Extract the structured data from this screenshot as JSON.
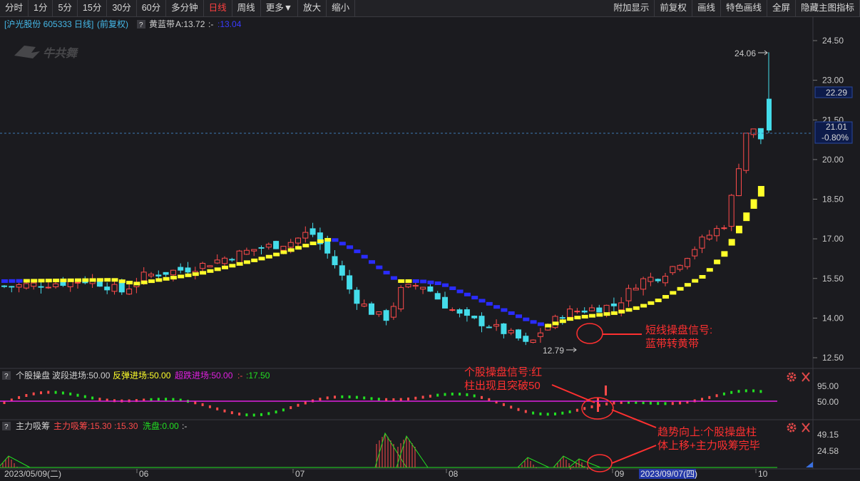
{
  "toolbar": {
    "left": [
      "分时",
      "1分",
      "5分",
      "15分",
      "30分",
      "60分",
      "多分钟",
      "日线",
      "周线",
      "更多▼",
      "放大",
      "缩小"
    ],
    "active": "日线",
    "right": [
      "附加显示",
      "前复权",
      "画线",
      "特色画线",
      "全屏",
      "隐藏主图指标"
    ]
  },
  "main": {
    "stock_label": "[沪光股份 605333 日线]",
    "adjust_label": "(前复权)",
    "q_icon": "?",
    "indicator_name": "黄蓝带",
    "indicator_a": "A:13.72",
    "indicator_dash": ":-",
    "indicator_b": ":13.04",
    "watermark": "牛共舞",
    "high_label": "24.06",
    "low_label": "12.79",
    "price_ticks": [
      "24.50",
      "23.00",
      "21.50",
      "20.00",
      "18.50",
      "17.00",
      "15.50",
      "14.00",
      "12.50"
    ],
    "badge_top": "22.29",
    "badge_price": "21.01",
    "badge_pct": "-0.80%"
  },
  "ind1": {
    "q_icon": "?",
    "name": "个股操盘",
    "s1": "波段进场:50.00",
    "s2": "反弹进场:50.00",
    "s3": "超跌进场:50.00",
    "s4": ":-",
    "s5": ":17.50",
    "ticks": [
      "95.00",
      "50.00"
    ]
  },
  "ind2": {
    "q_icon": "?",
    "name": "主力吸筹",
    "s1": "主力吸筹:15.30",
    "s2": ":15.30",
    "s3": "洗盘:0.00",
    "s4": ":-",
    "ticks": [
      "49.15",
      "24.58"
    ]
  },
  "xaxis": {
    "start": "2023/05/09(二)",
    "months": [
      "06",
      "07",
      "08",
      "09",
      "10"
    ],
    "cursor_date": "2023/09/07(四)"
  },
  "annotations": {
    "a1": [
      "短线操盘信号:",
      "蓝带转黄带"
    ],
    "a2": [
      "个股操盘信号:红",
      "柱出现且突破50"
    ],
    "a3": [
      "趋势向上:个股操盘柱",
      "体上移+主力吸筹完毕"
    ]
  },
  "colors": {
    "bg": "#1b1b1f",
    "up": "#ff4b4b",
    "down": "#44dcea",
    "yellow": "#ffff2a",
    "blue": "#2a2cff",
    "green": "#22e022",
    "magenta": "#e020e0",
    "annotation": "#ff3030"
  }
}
